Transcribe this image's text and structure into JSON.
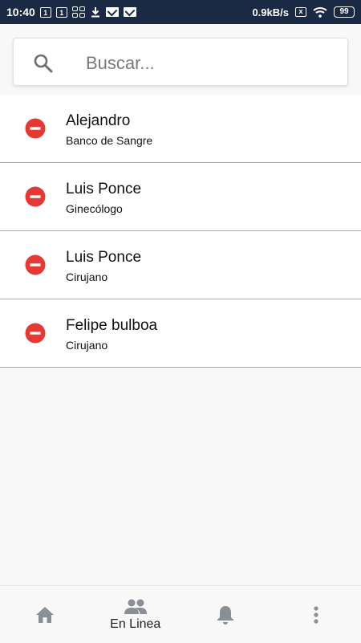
{
  "status_bar": {
    "time": "10:40",
    "notif_box_1": "1",
    "notif_box_2": "1",
    "network_speed": "0.9kB/s",
    "sim_label": "x",
    "battery": "99"
  },
  "search": {
    "placeholder": "Buscar..."
  },
  "contacts": [
    {
      "name": "Alejandro",
      "role": "Banco de Sangre"
    },
    {
      "name": "Luis Ponce",
      "role": "Ginecólogo"
    },
    {
      "name": "Luis Ponce",
      "role": "Cirujano"
    },
    {
      "name": "Felipe bulboa",
      "role": "Cirujano"
    }
  ],
  "bottom_nav": {
    "items": [
      {
        "icon": "home-icon",
        "label": ""
      },
      {
        "icon": "people-icon",
        "label": "En Linea"
      },
      {
        "icon": "bell-icon",
        "label": ""
      },
      {
        "icon": "more-vert-icon",
        "label": ""
      }
    ],
    "active_index": 1
  },
  "colors": {
    "status_bar_bg": "#1b2a44",
    "remove_red": "#e53935",
    "icon_gray": "#8a8f95",
    "divider": "#a9a9a9"
  }
}
